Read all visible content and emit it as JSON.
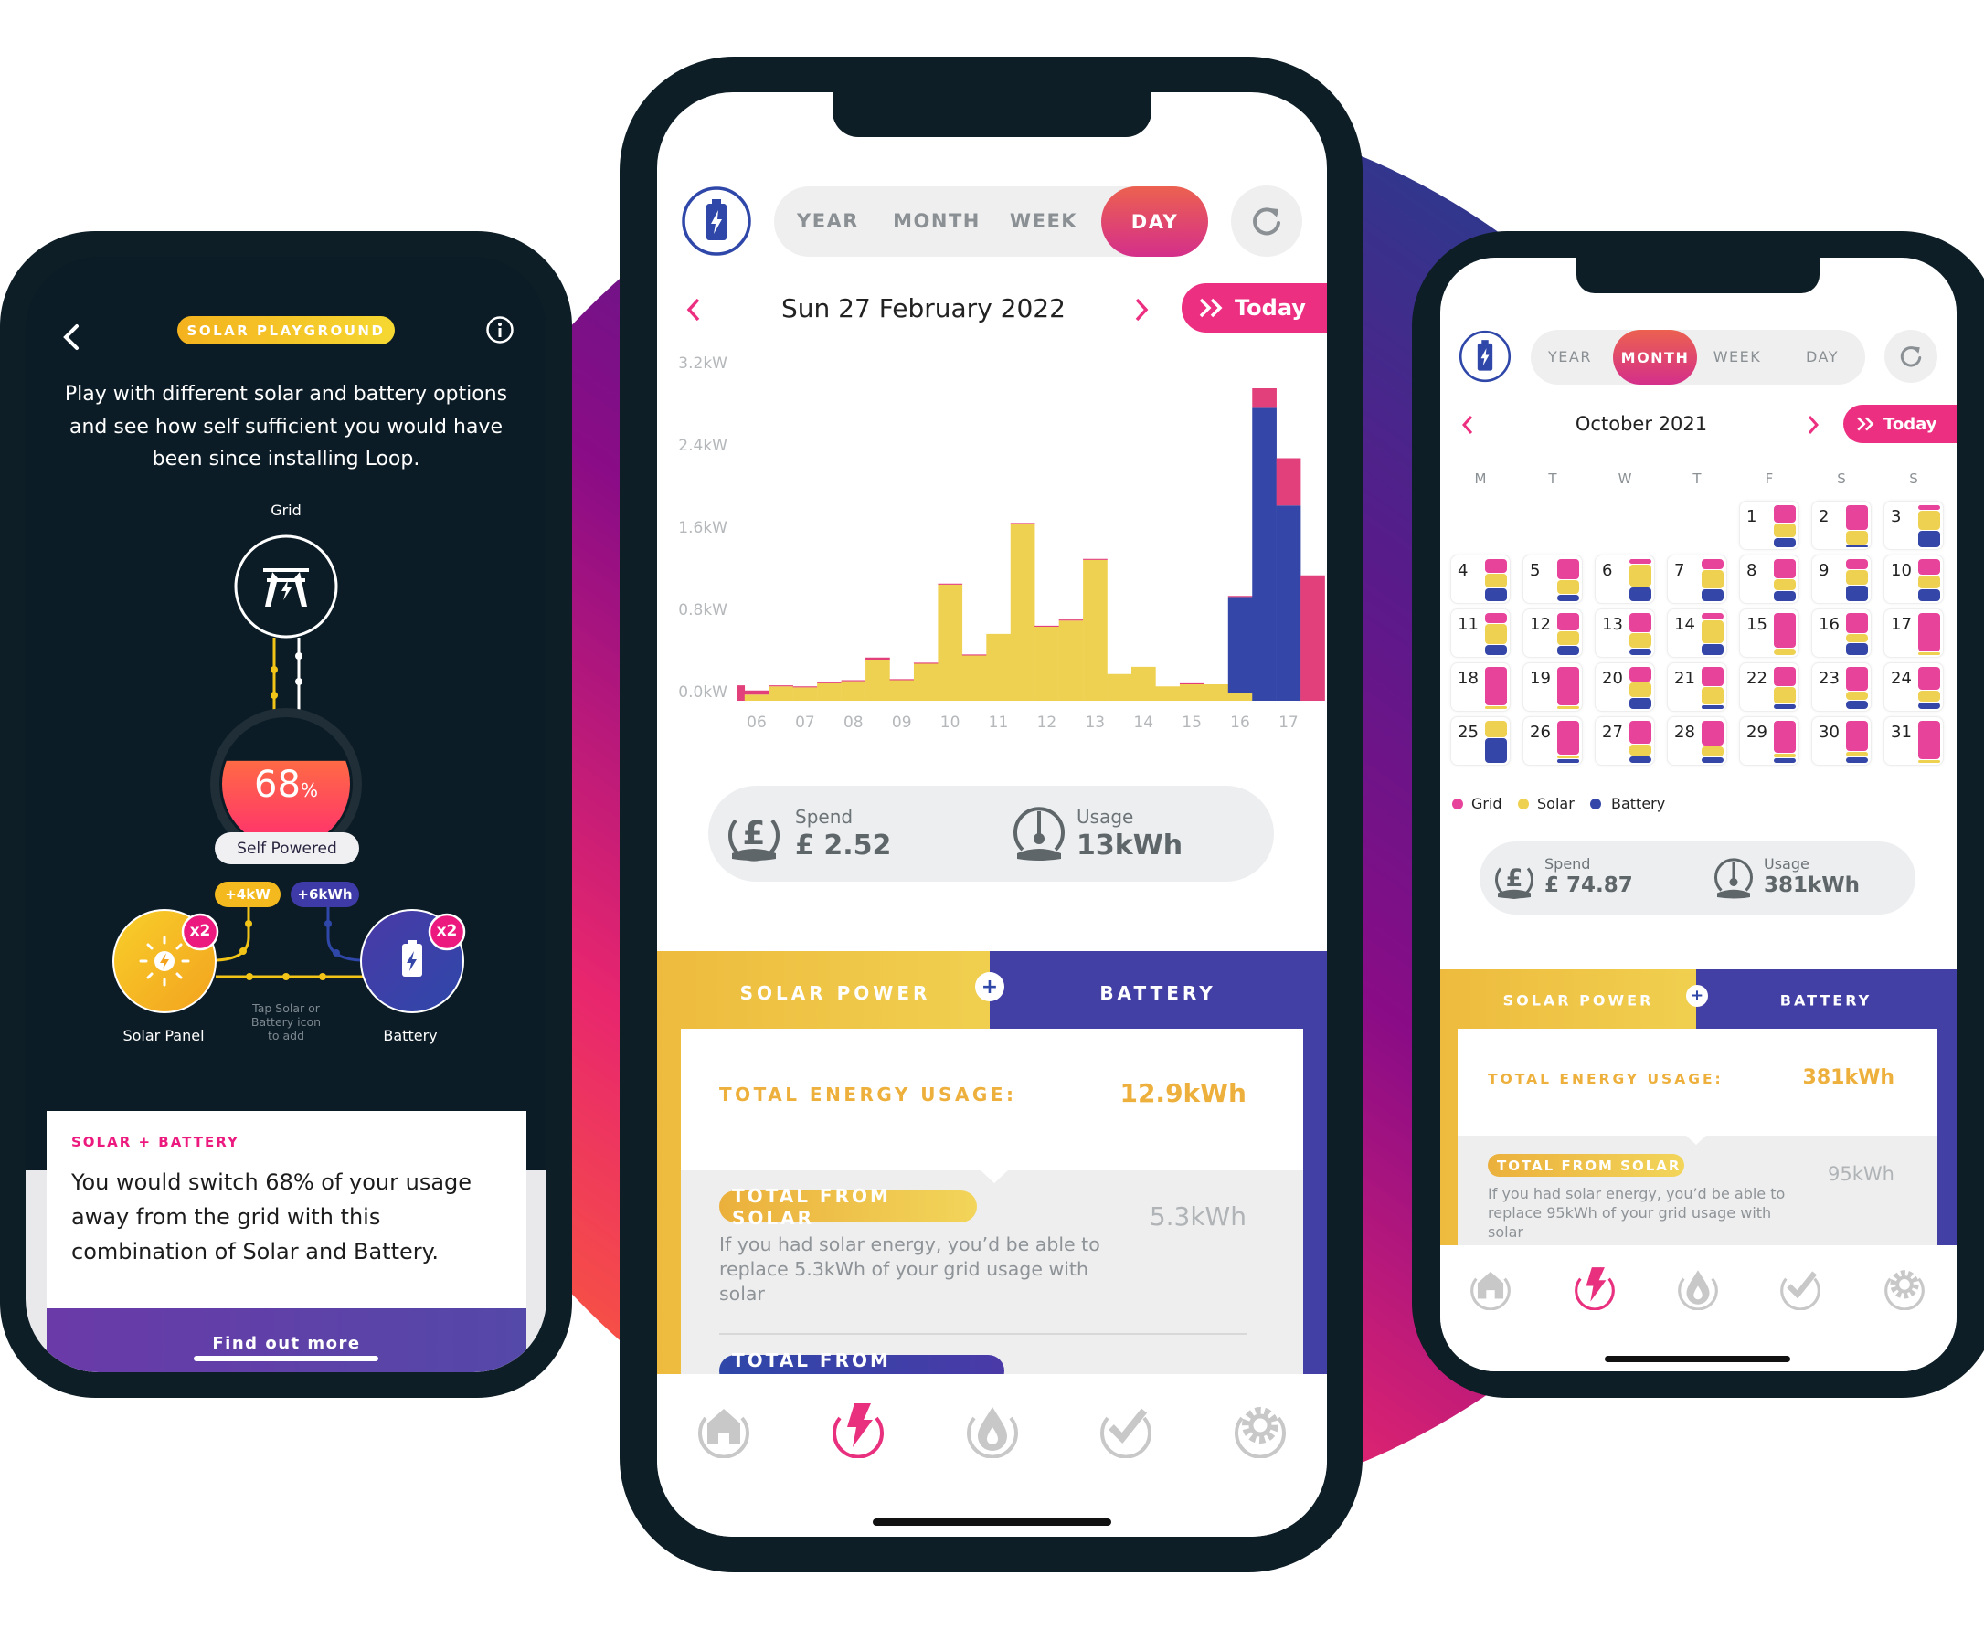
{
  "colors": {
    "grid": "#e8439a",
    "solar": "#efd152",
    "battery": "#3446a8",
    "accent": "#ec2f80",
    "dark": "#0e1e26"
  },
  "left_phone": {
    "back_icon": "chevron-left-icon",
    "badge": "SOLAR PLAYGROUND",
    "info_icon": "info-icon",
    "intro": [
      "Play with different solar and battery options",
      "and see how self sufficient you would have",
      "been since installing Loop."
    ],
    "grid_label": "Grid",
    "self_powered_percent": "68",
    "percent_sign": "%",
    "self_powered_fraction": 0.68,
    "self_powered_label": "Self Powered",
    "solar_added": "+4kW",
    "battery_added": "+6kWh",
    "solar_multiplier": "x2",
    "battery_multiplier": "x2",
    "solar_label": "Solar Panel",
    "battery_label": "Battery",
    "hint": [
      "Tap Solar or",
      "Battery icon",
      "to add"
    ],
    "card": {
      "eyebrow": "SOLAR + BATTERY",
      "body": [
        "You would switch 68% of your usage",
        "away from the grid with this",
        "combination of Solar and Battery."
      ],
      "button": "Find out more"
    }
  },
  "center_phone": {
    "period_tabs": [
      "YEAR",
      "MONTH",
      "WEEK",
      "DAY"
    ],
    "active_tab": "DAY",
    "date": "Sun 27 February 2022",
    "today": "Today",
    "summary": {
      "spend_label": "Spend",
      "spend": "£ 2.52",
      "usage_label": "Usage",
      "usage": "13kWh"
    },
    "sections": {
      "solar_tab": "SOLAR POWER",
      "battery_tab": "BATTERY",
      "total_label": "TOTAL ENERGY USAGE:",
      "total_value": "12.9kWh",
      "solar_pill": "TOTAL FROM SOLAR",
      "solar_value": "5.3kWh",
      "solar_desc": "If you had solar energy, you’d be able to replace 5.3kWh of your grid usage with solar",
      "battery_pill": "TOTAL FROM BATTERY"
    },
    "nav": [
      "home-icon",
      "energy-icon",
      "gas-icon",
      "tasks-icon",
      "settings-icon"
    ],
    "active_nav": 1
  },
  "chart_data": {
    "type": "bar",
    "stacked": true,
    "x": [
      "05:30",
      "06:00",
      "06:30",
      "07:00",
      "07:30",
      "08:00",
      "08:30",
      "09:00",
      "09:30",
      "10:00",
      "10:30",
      "11:00",
      "11:30",
      "12:00",
      "12:30",
      "13:00",
      "13:30",
      "14:00",
      "14:30",
      "15:00",
      "15:30",
      "16:00",
      "16:30",
      "17:00",
      "17:30"
    ],
    "series": [
      {
        "color": "#efd152",
        "values": [
          0,
          0.06,
          0.14,
          0.13,
          0.17,
          0.19,
          0.4,
          0.2,
          0.36,
          1.13,
          0.44,
          0.65,
          1.72,
          0.72,
          0.78,
          1.37,
          0.26,
          0.33,
          0.14,
          0.16,
          0.16,
          0.08,
          0,
          0,
          0
        ]
      },
      {
        "color": "#3446a8",
        "values": [
          0,
          0,
          0,
          0,
          0,
          0,
          0,
          0,
          0,
          0,
          0,
          0,
          0,
          0,
          0,
          0,
          0,
          0,
          0,
          0,
          0,
          0.93,
          2.85,
          1.9,
          0
        ]
      },
      {
        "color": "#e2407a",
        "values": [
          0.15,
          0.04,
          0.01,
          0.01,
          0.01,
          0.01,
          0.02,
          0.01,
          0.01,
          0.01,
          0.01,
          0,
          0.01,
          0.01,
          0.01,
          0.01,
          0,
          0,
          0,
          0.01,
          0,
          0.01,
          0.19,
          0.46,
          1.22
        ]
      }
    ],
    "x_tick_labels": [
      "06",
      "07",
      "08",
      "09",
      "10",
      "11",
      "12",
      "13",
      "14",
      "15",
      "16",
      "17"
    ],
    "y_tick_labels": [
      "0.0kW",
      "0.8kW",
      "1.6kW",
      "2.4kW",
      "3.2kW"
    ],
    "y_tick_values": [
      0,
      0.8,
      1.6,
      2.4,
      3.2
    ],
    "ylim": [
      0,
      3.2
    ],
    "grid": false
  },
  "right_phone": {
    "period_tabs": [
      "YEAR",
      "MONTH",
      "WEEK",
      "DAY"
    ],
    "active_tab": "MONTH",
    "date": "October 2021",
    "today": "Today",
    "weekdays": [
      "M",
      "T",
      "W",
      "T",
      "F",
      "S",
      "S"
    ],
    "first_weekday_index": 4,
    "days": [
      {
        "d": "1",
        "grid": 0.44,
        "solar": 0.33,
        "battery": 0.23
      },
      {
        "d": "2",
        "grid": 0.62,
        "solar": 0.33,
        "battery": 0.05
      },
      {
        "d": "3",
        "grid": 0.11,
        "solar": 0.49,
        "battery": 0.4
      },
      {
        "d": "4",
        "grid": 0.34,
        "solar": 0.35,
        "battery": 0.31
      },
      {
        "d": "5",
        "grid": 0.49,
        "solar": 0.36,
        "battery": 0.15
      },
      {
        "d": "6",
        "grid": 0.12,
        "solar": 0.55,
        "battery": 0.33
      },
      {
        "d": "7",
        "grid": 0.25,
        "solar": 0.45,
        "battery": 0.3
      },
      {
        "d": "8",
        "grid": 0.47,
        "solar": 0.29,
        "battery": 0.24
      },
      {
        "d": "9",
        "grid": 0.24,
        "solar": 0.37,
        "battery": 0.39
      },
      {
        "d": "10",
        "grid": 0.39,
        "solar": 0.31,
        "battery": 0.3
      },
      {
        "d": "11",
        "grid": 0.24,
        "solar": 0.5,
        "battery": 0.26
      },
      {
        "d": "12",
        "grid": 0.44,
        "solar": 0.34,
        "battery": 0.22
      },
      {
        "d": "13",
        "grid": 0.47,
        "solar": 0.38,
        "battery": 0.15
      },
      {
        "d": "14",
        "grid": 0.15,
        "solar": 0.58,
        "battery": 0.27
      },
      {
        "d": "15",
        "grid": 0.85,
        "solar": 0.15,
        "battery": 0
      },
      {
        "d": "16",
        "grid": 0.51,
        "solar": 0.2,
        "battery": 0.29
      },
      {
        "d": "17",
        "grid": 0.94,
        "solar": 0.06,
        "battery": 0
      },
      {
        "d": "18",
        "grid": 0.93,
        "solar": 0.07,
        "battery": 0
      },
      {
        "d": "19",
        "grid": 0.93,
        "solar": 0.07,
        "battery": 0
      },
      {
        "d": "20",
        "grid": 0.37,
        "solar": 0.36,
        "battery": 0.27
      },
      {
        "d": "21",
        "grid": 0.48,
        "solar": 0.42,
        "battery": 0.1
      },
      {
        "d": "22",
        "grid": 0.48,
        "solar": 0.41,
        "battery": 0.11
      },
      {
        "d": "23",
        "grid": 0.58,
        "solar": 0.22,
        "battery": 0.2
      },
      {
        "d": "24",
        "grid": 0.57,
        "solar": 0.27,
        "battery": 0.16
      },
      {
        "d": "25",
        "grid": 0,
        "solar": 0.4,
        "battery": 0.6
      },
      {
        "d": "26",
        "grid": 0.83,
        "solar": 0.08,
        "battery": 0.09
      },
      {
        "d": "27",
        "grid": 0.57,
        "solar": 0.27,
        "battery": 0.16
      },
      {
        "d": "28",
        "grid": 0.61,
        "solar": 0.26,
        "battery": 0.13
      },
      {
        "d": "29",
        "grid": 0.8,
        "solar": 0.09,
        "battery": 0.11
      },
      {
        "d": "30",
        "grid": 0.76,
        "solar": 0.11,
        "battery": 0.13
      },
      {
        "d": "31",
        "grid": 0.94,
        "solar": 0.06,
        "battery": 0
      }
    ],
    "legend": [
      "Grid",
      "Solar",
      "Battery"
    ],
    "summary": {
      "spend_label": "Spend",
      "spend": "£ 74.87",
      "usage_label": "Usage",
      "usage": "381kWh"
    },
    "sections": {
      "solar_tab": "SOLAR POWER",
      "battery_tab": "BATTERY",
      "total_label": "TOTAL ENERGY USAGE:",
      "total_value": "381kWh",
      "solar_pill": "TOTAL FROM SOLAR",
      "solar_value": "95kWh",
      "solar_desc": "If you had solar energy, you’d be able to replace 95kWh of your grid usage with solar"
    },
    "active_nav": 1
  }
}
